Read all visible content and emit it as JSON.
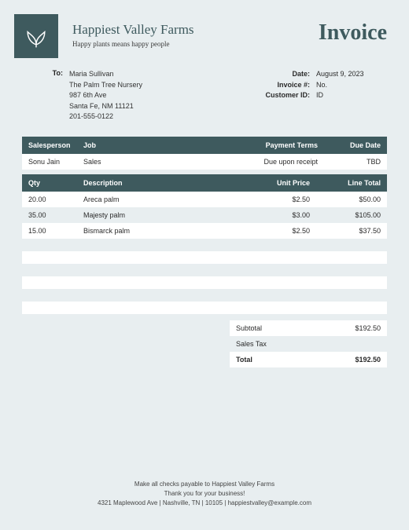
{
  "company": {
    "name": "Happiest Valley Farms",
    "tagline": "Happy plants means happy people"
  },
  "doc_title": "Invoice",
  "bill_to": {
    "label": "To:",
    "name": "Maria Sullivan",
    "line1": "The Palm Tree Nursery",
    "line2": "987 6th Ave",
    "line3": "Santa Fe, NM 11121",
    "line4": "201-555-0122"
  },
  "meta": {
    "date_label": "Date:",
    "date_value": "August 9, 2023",
    "invno_label": "Invoice #:",
    "invno_value": "No.",
    "custid_label": "Customer ID:",
    "custid_value": "ID"
  },
  "sales": {
    "headers": {
      "salesperson": "Salesperson",
      "job": "Job",
      "terms": "Payment Terms",
      "due": "Due Date"
    },
    "row": {
      "salesperson": "Sonu Jain",
      "job": "Sales",
      "terms": "Due upon receipt",
      "due": "TBD"
    }
  },
  "items": {
    "headers": {
      "qty": "Qty",
      "desc": "Description",
      "unit": "Unit Price",
      "total": "Line Total"
    },
    "rows": [
      {
        "qty": "20.00",
        "desc": "Areca palm",
        "unit": "$2.50",
        "total": "$50.00"
      },
      {
        "qty": "35.00",
        "desc": "Majesty palm",
        "unit": "$3.00",
        "total": "$105.00"
      },
      {
        "qty": "15.00",
        "desc": "Bismarck palm",
        "unit": "$2.50",
        "total": "$37.50"
      }
    ]
  },
  "totals": {
    "subtotal_label": "Subtotal",
    "subtotal_value": "$192.50",
    "tax_label": "Sales Tax",
    "tax_value": "",
    "grand_label": "Total",
    "grand_value": "$192.50"
  },
  "footer": {
    "line1": "Make all checks payable to Happiest Valley Farms",
    "line2": "Thank you for your business!",
    "line3": "4321 Maplewood Ave | Nashville, TN | 10105 | happiestvalley@example.com"
  }
}
